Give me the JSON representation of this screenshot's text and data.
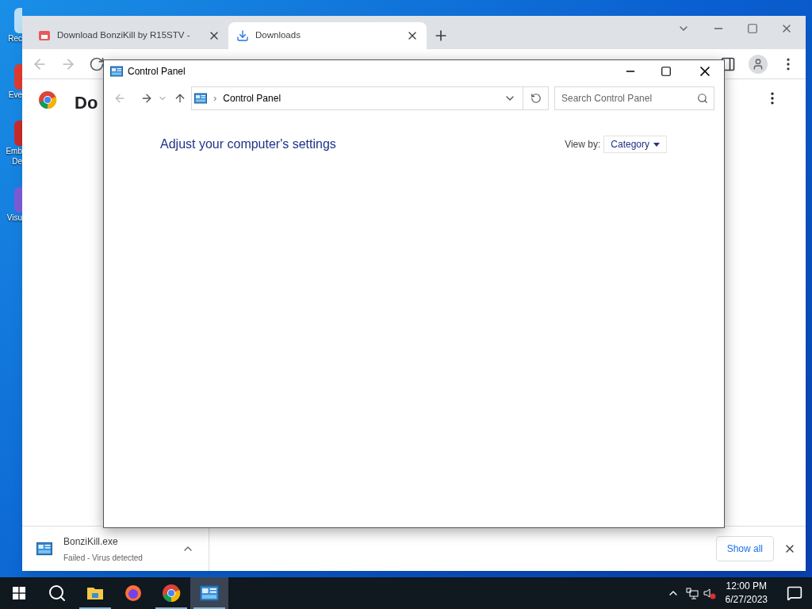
{
  "desktop": {
    "icons": [
      {
        "kind": "recycle",
        "lines": [
          "Rec"
        ]
      },
      {
        "kind": "event",
        "lines": [
          "Eve"
        ]
      },
      {
        "kind": "embarcadero",
        "lines": [
          "Emb",
          "De"
        ]
      },
      {
        "kind": "visual",
        "lines": [
          "Visu"
        ]
      }
    ]
  },
  "browser": {
    "tabs": [
      {
        "title": "Download BonziKill by R15STV -",
        "kind": "site",
        "selected": false
      },
      {
        "title": "Downloads",
        "kind": "downloads",
        "selected": true
      }
    ],
    "page_heading": "Do",
    "download": {
      "filename": "BonziKill.exe",
      "status": "Failed - Virus detected"
    },
    "show_all": "Show all"
  },
  "control_panel": {
    "title": "Control Panel",
    "breadcrumb_separator": "›",
    "breadcrumb": "Control Panel",
    "search": {
      "placeholder": "Search Control Panel"
    },
    "heading": "Adjust your computer's settings",
    "view_by_label": "View by:",
    "view_by_value": "Category"
  },
  "taskbar": {
    "apps": [
      {
        "kind": "folder",
        "running": true,
        "selected": false
      },
      {
        "kind": "firefox",
        "running": false,
        "selected": false
      },
      {
        "kind": "chrome",
        "running": true,
        "selected": false
      },
      {
        "kind": "control-panel",
        "running": true,
        "selected": true
      }
    ],
    "time": "12:00 PM",
    "date": "6/27/2023"
  }
}
